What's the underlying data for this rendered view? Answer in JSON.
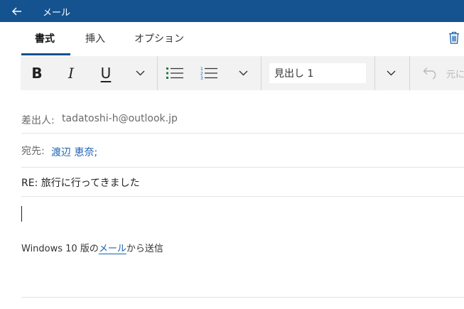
{
  "window": {
    "title": "メール",
    "back_icon": "back-arrow-icon"
  },
  "tabs": [
    {
      "label": "書式",
      "selected": true
    },
    {
      "label": "挿入",
      "selected": false
    },
    {
      "label": "オプション",
      "selected": false
    }
  ],
  "toolbar": {
    "bold_label": "B",
    "italic_label": "I",
    "underline_label": "U",
    "style_value": "見出し 1",
    "undo_label": "元に"
  },
  "header": {
    "from_label": "差出人:",
    "from_value": "tadatoshi-h@outlook.jp",
    "to_label": "宛先:",
    "to_value": "渡辺 恵奈;",
    "subject": "RE: 旅行に行ってきました"
  },
  "body": {
    "signature_prefix": "Windows 10 版の",
    "signature_link": "メール",
    "signature_suffix": "から送信"
  },
  "colors": {
    "titlebar": "#14538f",
    "accent": "#14538f",
    "link": "#1a62b0",
    "toolbar_bg": "#f2f2f2"
  }
}
